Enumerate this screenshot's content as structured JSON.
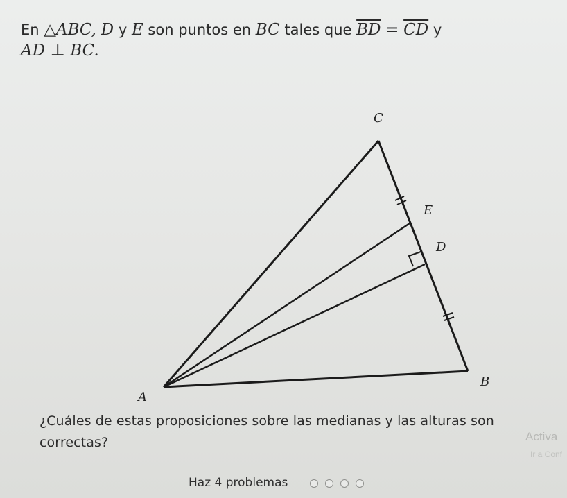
{
  "statement": {
    "prefix": "En",
    "triangle": "△ABC,",
    "point_d": "D",
    "y1": "y",
    "point_e": "E",
    "are_points_on": "son puntos en",
    "segment_bc": "BC",
    "such_that": "tales que",
    "bd_segment": "BD",
    "equals": "=",
    "cd_segment": "CD",
    "y2": "y",
    "perpendicular": "AD ⊥ BC."
  },
  "figure": {
    "label_c": "C",
    "label_e": "E",
    "label_d": "D",
    "label_b": "B",
    "label_a": "A"
  },
  "question": {
    "text": "¿Cuáles de estas proposiciones sobre las medianas y las alturas son correctas?"
  },
  "footer": {
    "problems_label": "Haz 4 problemas"
  },
  "watermark": {
    "activate": "Activa",
    "settings": "Ir a Conf"
  }
}
